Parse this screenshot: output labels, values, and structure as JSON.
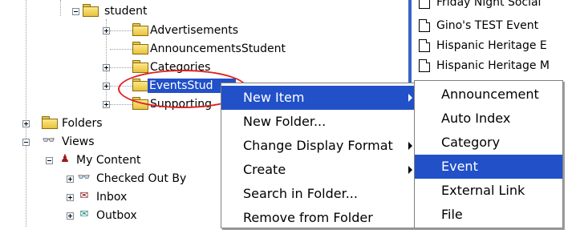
{
  "tree": {
    "student": "student",
    "advertisements": "Advertisements",
    "announcements_student": "AnnouncementsStudent",
    "categories": "Categories",
    "events_student": "EventsStud",
    "supporting": "Supporting",
    "folders": "Folders",
    "views": "Views",
    "my_content": "My Content",
    "checked_out_by": "Checked Out By",
    "inbox": "Inbox",
    "outbox": "Outbox"
  },
  "list": {
    "items": [
      "Friday Night Social",
      "Gino's TEST Event",
      "Hispanic Heritage E",
      "Hispanic Heritage M"
    ]
  },
  "context_menu": {
    "items": [
      {
        "label": "New Item"
      },
      {
        "label": "New Folder..."
      },
      {
        "label": "Change Display Format"
      },
      {
        "label": "Create"
      },
      {
        "label": "Search in Folder..."
      },
      {
        "label": "Remove from Folder"
      }
    ]
  },
  "submenu": {
    "items": [
      {
        "label": "Announcement"
      },
      {
        "label": "Auto Index"
      },
      {
        "label": "Category"
      },
      {
        "label": "Event"
      },
      {
        "label": "External Link"
      },
      {
        "label": "File"
      }
    ]
  },
  "colors": {
    "selection": "#2150c8",
    "highlight_circle": "#e02020"
  }
}
